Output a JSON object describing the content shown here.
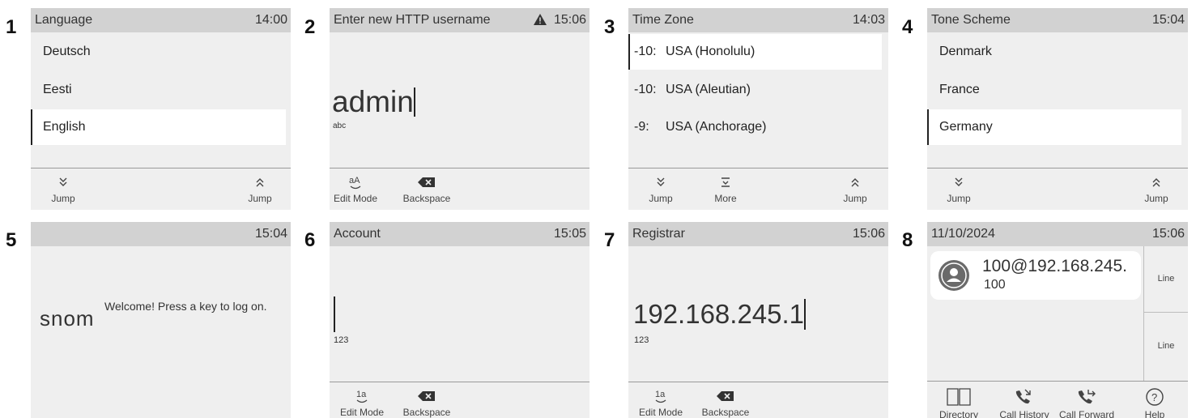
{
  "panels": {
    "p1": {
      "number": "1",
      "title": "Language",
      "time": "14:00",
      "items": [
        "Deutsch",
        "Eesti",
        "English"
      ],
      "keys": {
        "left": "Jump",
        "right": "Jump"
      }
    },
    "p2": {
      "number": "2",
      "title": "Enter new HTTP username",
      "time": "15:06",
      "value": "admin",
      "mode": "abc",
      "keys": {
        "edit": "Edit Mode",
        "backspace": "Backspace"
      }
    },
    "p3": {
      "number": "3",
      "title": "Time Zone",
      "time": "14:03",
      "items": [
        {
          "offset": "-10:",
          "name": "USA (Honolulu)"
        },
        {
          "offset": "-10:",
          "name": "USA (Aleutian)"
        },
        {
          "offset": "-9:",
          "name": "USA (Anchorage)"
        }
      ],
      "keys": {
        "left": "Jump",
        "more": "More",
        "right": "Jump"
      }
    },
    "p4": {
      "number": "4",
      "title": "Tone Scheme",
      "time": "15:04",
      "items": [
        "Denmark",
        "France",
        "Germany"
      ],
      "keys": {
        "left": "Jump",
        "right": "Jump"
      }
    },
    "p5": {
      "number": "5",
      "time": "15:04",
      "logo": "snom",
      "message": "Welcome! Press a key to log on."
    },
    "p6": {
      "number": "6",
      "title": "Account",
      "time": "15:05",
      "value": "",
      "mode": "123",
      "keys": {
        "edit": "Edit Mode",
        "backspace": "Backspace"
      }
    },
    "p7": {
      "number": "7",
      "title": "Registrar",
      "time": "15:06",
      "value": "192.168.245.1",
      "mode": "123",
      "keys": {
        "edit": "Edit Mode",
        "backspace": "Backspace"
      }
    },
    "p8": {
      "number": "8",
      "title": "11/10/2024",
      "time": "15:06",
      "identity": "100@192.168.245.",
      "ext": "100",
      "lines": [
        "Line",
        "Line"
      ],
      "keys": {
        "directory": "Directory",
        "history": "Call History",
        "forward": "Call Forward",
        "help": "Help"
      }
    }
  },
  "icons": {
    "jump_down": "double-chevron-down-icon",
    "jump_up": "double-chevron-up-icon",
    "more": "more-icon",
    "edit_mode": "edit-mode-icon",
    "backspace": "backspace-icon",
    "warning": "warning-icon"
  },
  "colors": {
    "title_bar": "#d2d2d2",
    "screen": "#efefef",
    "selected": "#ffffff"
  }
}
